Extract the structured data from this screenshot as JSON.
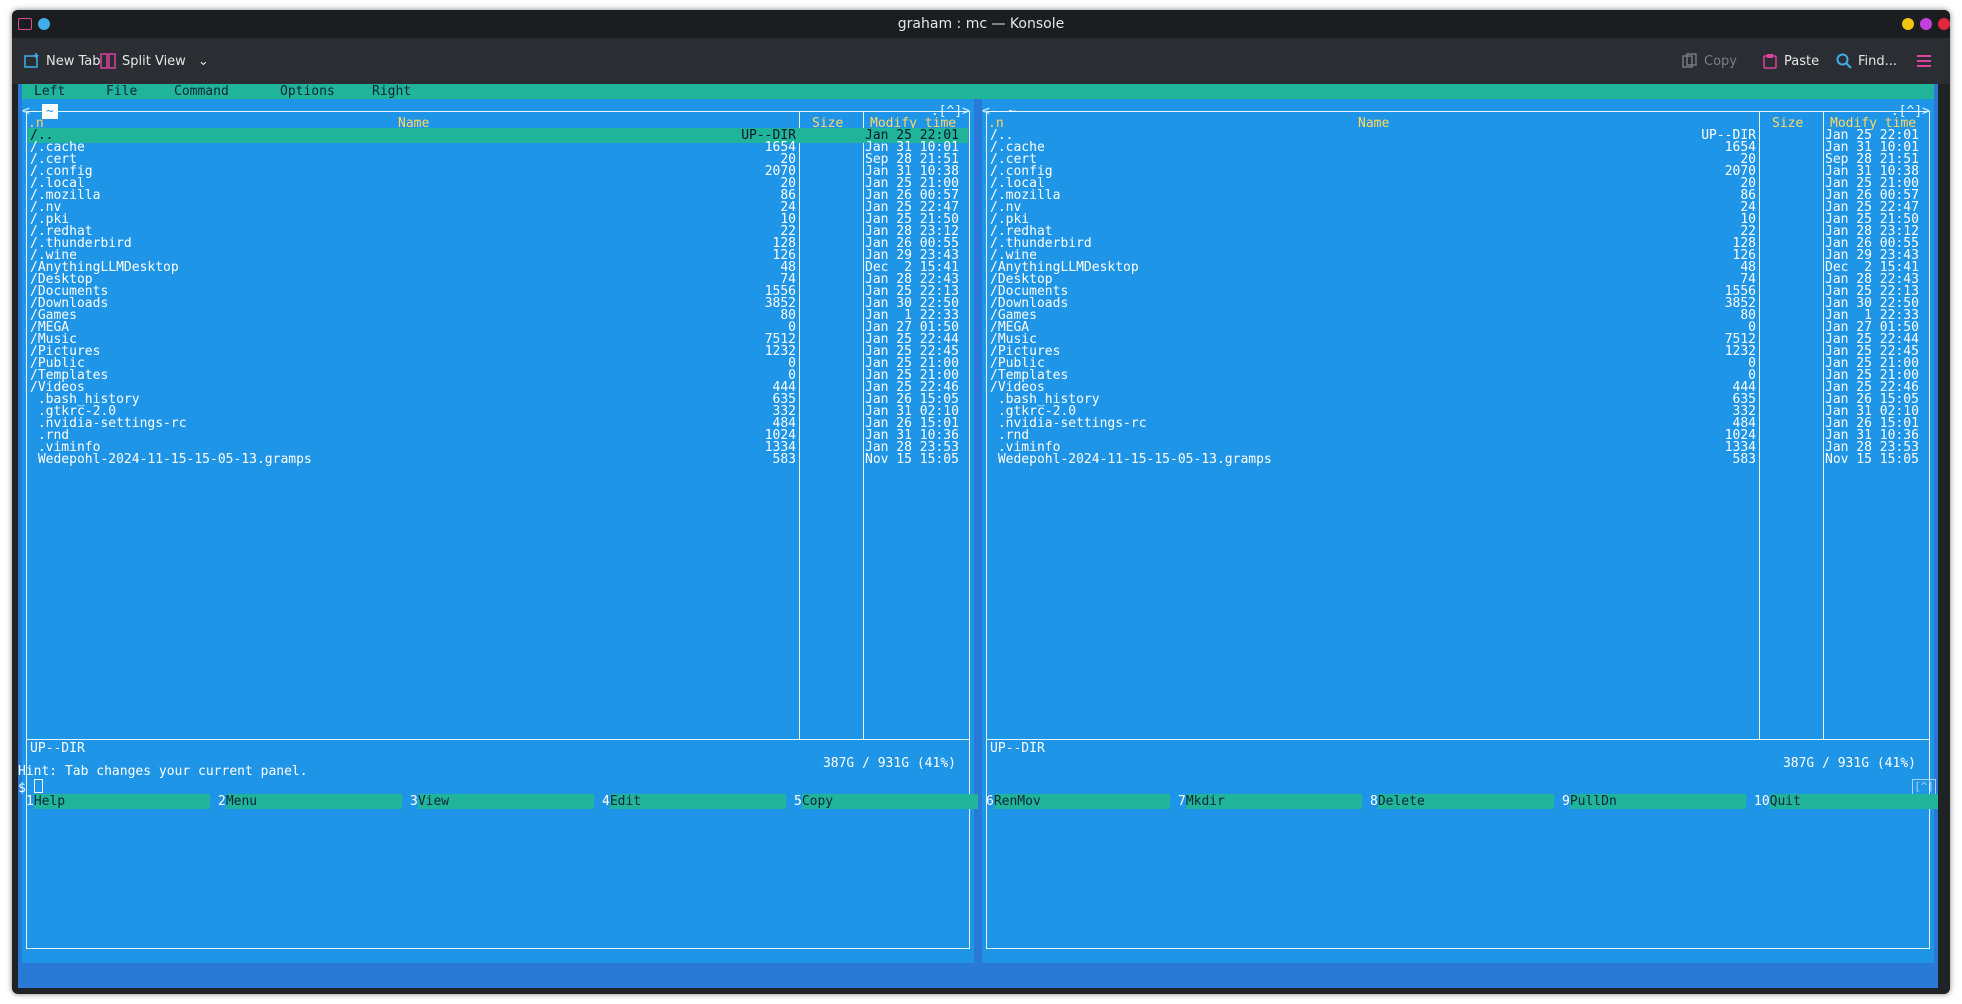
{
  "window": {
    "title": "graham : mc — Konsole",
    "controls_colors": [
      "#f1c40f",
      "#c23fe0",
      "#e0283c"
    ]
  },
  "toolbar": {
    "new_tab": "New Tab",
    "split_view": "Split View",
    "copy": "Copy",
    "paste": "Paste",
    "find": "Find..."
  },
  "menubar": [
    "Left",
    "File",
    "Command",
    "Options",
    "Right"
  ],
  "panels": {
    "left": {
      "path": "~",
      "left_marker": "<-",
      "right_marker": ".[^]>",
      "headers": {
        "sort": ".n",
        "name": "Name",
        "size": "Size",
        "mtime": "Modify time"
      },
      "mini_status": "UP--DIR",
      "free_space": "387G / 931G (41%)"
    },
    "right": {
      "path": "~",
      "left_marker": "<-",
      "right_marker": ".[^]>",
      "headers": {
        "sort": ".n",
        "name": "Name",
        "size": "Size",
        "mtime": "Modify time"
      },
      "mini_status": "UP--DIR",
      "free_space": "387G / 931G (41%)"
    }
  },
  "files": [
    {
      "name": "/..",
      "size": "UP--DIR",
      "mtime": "Jan 25 22:01"
    },
    {
      "name": "/.cache",
      "size": "1654",
      "mtime": "Jan 31 10:01"
    },
    {
      "name": "/.cert",
      "size": "20",
      "mtime": "Sep 28 21:51"
    },
    {
      "name": "/.config",
      "size": "2070",
      "mtime": "Jan 31 10:38"
    },
    {
      "name": "/.local",
      "size": "20",
      "mtime": "Jan 25 21:00"
    },
    {
      "name": "/.mozilla",
      "size": "86",
      "mtime": "Jan 26 00:57"
    },
    {
      "name": "/.nv",
      "size": "24",
      "mtime": "Jan 25 22:47"
    },
    {
      "name": "/.pki",
      "size": "10",
      "mtime": "Jan 25 21:50"
    },
    {
      "name": "/.redhat",
      "size": "22",
      "mtime": "Jan 28 23:12"
    },
    {
      "name": "/.thunderbird",
      "size": "128",
      "mtime": "Jan 26 00:55"
    },
    {
      "name": "/.wine",
      "size": "126",
      "mtime": "Jan 29 23:43"
    },
    {
      "name": "/AnythingLLMDesktop",
      "size": "48",
      "mtime": "Dec  2 15:41"
    },
    {
      "name": "/Desktop",
      "size": "74",
      "mtime": "Jan 28 22:43"
    },
    {
      "name": "/Documents",
      "size": "1556",
      "mtime": "Jan 25 22:13"
    },
    {
      "name": "/Downloads",
      "size": "3852",
      "mtime": "Jan 30 22:50"
    },
    {
      "name": "/Games",
      "size": "80",
      "mtime": "Jan  1 22:33"
    },
    {
      "name": "/MEGA",
      "size": "0",
      "mtime": "Jan 27 01:50"
    },
    {
      "name": "/Music",
      "size": "7512",
      "mtime": "Jan 25 22:44"
    },
    {
      "name": "/Pictures",
      "size": "1232",
      "mtime": "Jan 25 22:45"
    },
    {
      "name": "/Public",
      "size": "0",
      "mtime": "Jan 25 21:00"
    },
    {
      "name": "/Templates",
      "size": "0",
      "mtime": "Jan 25 21:00"
    },
    {
      "name": "/Videos",
      "size": "444",
      "mtime": "Jan 25 22:46"
    },
    {
      "name": " .bash_history",
      "size": "635",
      "mtime": "Jan 26 15:05"
    },
    {
      "name": " .gtkrc-2.0",
      "size": "332",
      "mtime": "Jan 31 02:10"
    },
    {
      "name": " .nvidia-settings-rc",
      "size": "484",
      "mtime": "Jan 26 15:01"
    },
    {
      "name": " .rnd",
      "size": "1024",
      "mtime": "Jan 31 10:36"
    },
    {
      "name": " .viminfo",
      "size": "1334",
      "mtime": "Jan 28 23:53"
    },
    {
      "name": " Wedepohl-2024-11-15-15-05-13.gramps",
      "size": "583",
      "mtime": "Nov 15 15:05"
    }
  ],
  "hint": "Hint: Tab changes your current panel.",
  "prompt": "$",
  "fkeys": [
    {
      "num": "1",
      "label": "Help"
    },
    {
      "num": "2",
      "label": "Menu"
    },
    {
      "num": "3",
      "label": "View"
    },
    {
      "num": "4",
      "label": "Edit"
    },
    {
      "num": "5",
      "label": "Copy"
    },
    {
      "num": "6",
      "label": "RenMov"
    },
    {
      "num": "7",
      "label": "Mkdir"
    },
    {
      "num": "8",
      "label": "Delete"
    },
    {
      "num": "9",
      "label": "PullDn"
    },
    {
      "num": "10",
      "label": "Quit"
    }
  ],
  "corner_button": "[^]"
}
